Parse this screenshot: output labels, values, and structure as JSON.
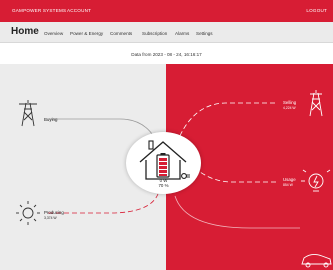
{
  "topbar": {
    "brand": "GAMPOWER SYSTEMS",
    "account": "ACCOUNT",
    "logout": "LOGOUT"
  },
  "nav": {
    "home": "Home",
    "tabs": [
      "Overview",
      "Power & Energy",
      "Comments",
      "Subscription",
      "Alarms",
      "Settings"
    ]
  },
  "date_text": "Data from 2023 - 08 - 24, 16:16:17",
  "flows": {
    "buying": {
      "label": "Buying",
      "value": ""
    },
    "producing": {
      "label": "Producing",
      "value": "3,374 W"
    },
    "selling": {
      "label": "Selling",
      "value": "4,224 W"
    },
    "usage": {
      "label": "Usage",
      "value": "854 W"
    },
    "battery_power": "0 W",
    "battery_soc": "70 %"
  },
  "colors": {
    "accent": "#d71d34",
    "panel_light": "#ececec"
  },
  "icons": [
    "power-tower-icon",
    "sun-icon",
    "house-battery-icon",
    "lightbulb-icon",
    "car-icon"
  ]
}
